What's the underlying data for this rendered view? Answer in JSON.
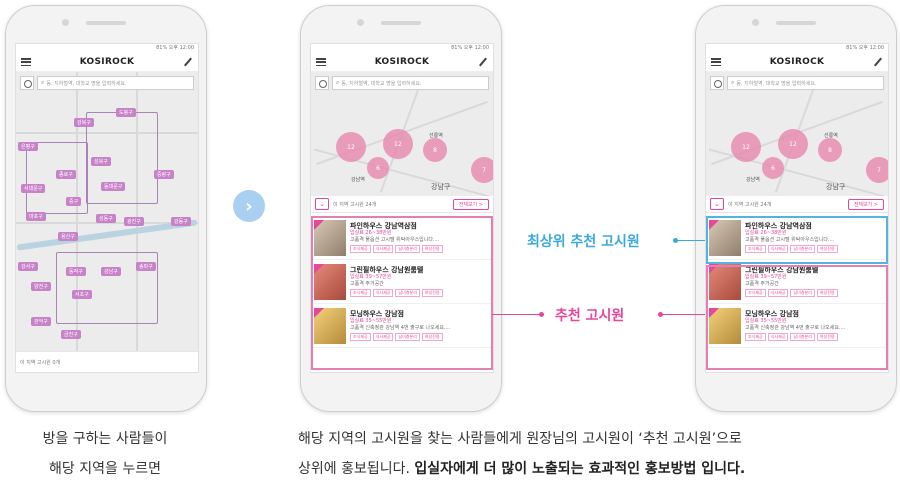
{
  "phones": [
    {
      "status": "81% 오후 12:00",
      "logo": "KOSIROCK",
      "search_placeholder": "동, 지하철역, 대학교 명을 입력하세요.",
      "district_pins": [
        "강북구",
        "도봉구",
        "은평구",
        "성북구",
        "종로구",
        "동대문구",
        "중랑구",
        "서대문구",
        "중구",
        "마포구",
        "성동구",
        "광진구",
        "용산구",
        "강동구",
        "강서구",
        "동작구",
        "강남구",
        "송파구",
        "양천구",
        "서초구",
        "관악구",
        "금천구"
      ],
      "footer_text": "이 지역 고시원 0개"
    },
    {
      "status": "81% 오후 12:00",
      "logo": "KOSIROCK",
      "search_placeholder": "동, 지하철역, 대학교 명을 입력하세요.",
      "clusters": [
        "12",
        "12",
        "6",
        "8",
        "7"
      ],
      "map_labels": [
        "강남역",
        "선릉역",
        "강남구"
      ],
      "count_text": "이 지역 고시원 24개",
      "all_button": "전체보기 >",
      "items": [
        {
          "name": "파인하우스 강남역삼점",
          "price": "입실료 26~38만원",
          "desc": "고품격 풀옵션 고시텔 위탁아우스입니다....",
          "tags": [
            "조식제공",
            "식사제공",
            "남녀층분리",
            "여성전용"
          ]
        },
        {
          "name": "그린필하우스 강남원룸텔",
          "price": "입실료 39~57만원",
          "desc": "고품격 주거공간",
          "tags": [
            "조식제공",
            "식사제공",
            "남녀층분리",
            "여성전용"
          ]
        },
        {
          "name": "모닝하우스 강남점",
          "price": "입실료 35~55만원",
          "desc": "고품격 신축정관 강남역 4번 출구로 나오세요....",
          "tags": [
            "조식제공",
            "식사제공",
            "남녀층분리",
            "여성전용"
          ]
        }
      ]
    },
    {
      "status": "81% 오후 12:00",
      "logo": "KOSIROCK",
      "search_placeholder": "동, 지하철역, 대학교 명을 입력하세요.",
      "clusters": [
        "12",
        "12",
        "6",
        "8",
        "7"
      ],
      "map_labels": [
        "선릉역",
        "강남구",
        "강남역"
      ],
      "count_text": "이 지역 고시원 24개",
      "all_button": "전체보기 >",
      "items": [
        {
          "name": "파인하우스 강남역삼점",
          "price": "입실료 26~38만원",
          "desc": "고품격 풀옵션 고시텔 위탁아우스입니다....",
          "tags": [
            "조식제공",
            "식사제공",
            "남녀층분리",
            "여성전용"
          ]
        },
        {
          "name": "그린필하우스 강남원룸텔",
          "price": "입실료 39~57만원",
          "desc": "고품격 주거공간",
          "tags": [
            "조식제공",
            "식사제공",
            "남녀층분리",
            "여성전용"
          ]
        },
        {
          "name": "모닝하우스 강남점",
          "price": "입실료 35~55만원",
          "desc": "고품격 신축정관 강남역 4번 출구로 나오세요....",
          "tags": [
            "조식제공",
            "식사제공",
            "남녀층분리",
            "여성전용"
          ]
        }
      ]
    }
  ],
  "annotations": {
    "top_recommended": "최상위 추천 고시원",
    "recommended": "추천 고시원"
  },
  "captions": {
    "left_line1": "방을 구하는 사람들이",
    "left_line2": "해당 지역을 누르면",
    "right_line1": "해당 지역의 고시원을 찾는 사람들에게 원장님의 고시원이 ‘추천 고시원’으로",
    "right_line2_plain": "상위에 홍보됩니다. ",
    "right_line2_bold": "입실자에게 더 많이 노출되는 효과적인 홍보방법 입니다."
  },
  "colors": {
    "accent_pink": "#e6479a",
    "accent_blue": "#3aa9dd",
    "arrow_circle": "#a9cff1",
    "district_pin": "#c883c8",
    "cluster": "#e880aa"
  },
  "icons": [
    "menu-icon",
    "pen-icon",
    "location-target-icon",
    "search-icon",
    "chevron-down-icon",
    "arrow-right-icon"
  ]
}
